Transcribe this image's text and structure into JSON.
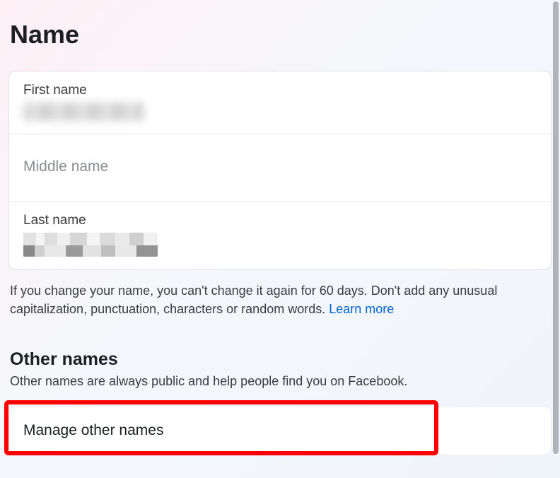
{
  "page_title": "Name",
  "fields": {
    "first_name_label": "First name",
    "middle_name_label": "Middle name",
    "last_name_label": "Last name"
  },
  "info_text_1": "If you change your name, you can't change it again for 60 days. Don't add any unusual capitalization, punctuation, characters or random words. ",
  "learn_more_label": "Learn more",
  "other_names": {
    "title": "Other names",
    "subtitle": "Other names are always public and help people find you on Facebook.",
    "manage_label": "Manage other names"
  }
}
